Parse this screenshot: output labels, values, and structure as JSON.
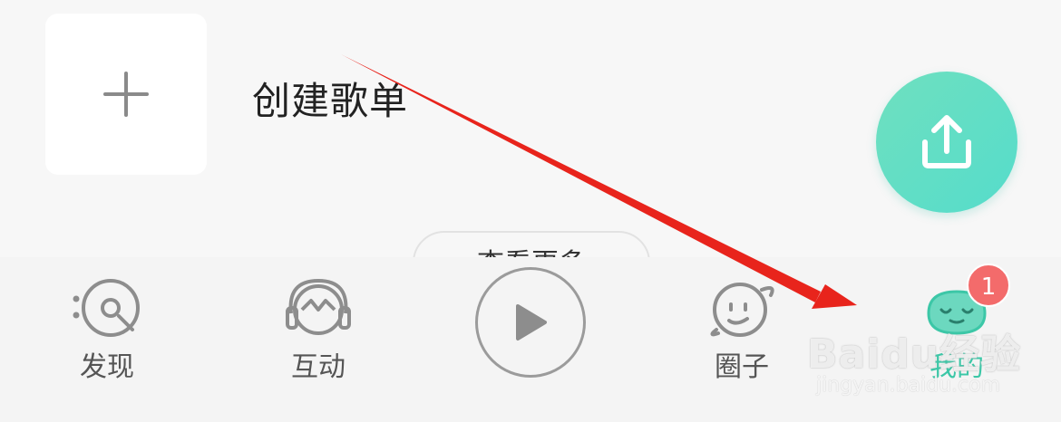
{
  "content": {
    "create_playlist_label": "创建歌单",
    "view_more_label": "查看更多"
  },
  "tabbar": {
    "tabs": [
      {
        "label": "发现",
        "icon": "disc-icon"
      },
      {
        "label": "互动",
        "icon": "headphones-face-icon"
      },
      {
        "label": "圈子",
        "icon": "planet-face-icon"
      },
      {
        "label": "我的",
        "icon": "mascot-face-icon",
        "active": true
      }
    ],
    "badge_count": "1"
  },
  "colors": {
    "accent": "#3cc7a7",
    "fab_start": "#6fe0bf",
    "fab_end": "#55dccb",
    "badge": "#f36b6b",
    "arrow": "#e8241c"
  },
  "watermark": {
    "brand": "Baidu经验",
    "url": "jingyan.baidu.com"
  }
}
